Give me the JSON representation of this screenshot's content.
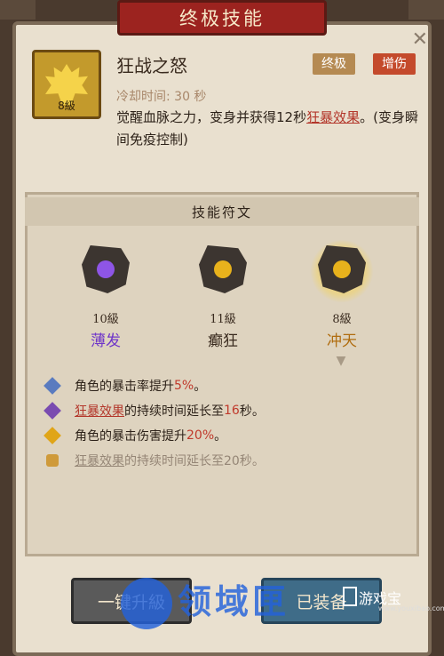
{
  "panel": {
    "title": "终极技能",
    "close_glyph": "✕"
  },
  "skill": {
    "name": "狂战之怒",
    "level": "8級",
    "tags": [
      "终极",
      "增伤"
    ],
    "cooldown": "冷却时间: 30 秒",
    "desc_part1": "觉醒血脉之力，变身并获得12秒",
    "desc_link": "狂暴效果",
    "desc_part2": "。(变身瞬间免疫控制)"
  },
  "runes": {
    "header": "技能符文",
    "items": [
      {
        "level": "10級",
        "name": "薄发",
        "color": "#7a3fd6"
      },
      {
        "level": "11級",
        "name": "癫狂",
        "color": "#e0a518"
      },
      {
        "level": "8級",
        "name": "冲天",
        "color": "#e0a518"
      }
    ]
  },
  "effects": [
    {
      "pre": "角色的暴击率提升",
      "value": "5%",
      "post": "。",
      "icon_color": "#5a7bbf"
    },
    {
      "link": "狂暴效果",
      "pre": "的持续时间延长至",
      "value": "16",
      "post": "秒。",
      "icon_color": "#7a4bb0"
    },
    {
      "pre": "角色的暴击伤害提升",
      "value": "20%",
      "post": "。",
      "icon_color": "#e0a518"
    },
    {
      "link": "狂暴效果",
      "pre": "的持续时间延长至20秒。",
      "locked": true
    }
  ],
  "buttons": {
    "upgrade": "一键升級",
    "equip": "已装备"
  },
  "watermark": {
    "main": "领域匣",
    "site": "游戏宝",
    "url": "www.youxibao.com"
  }
}
